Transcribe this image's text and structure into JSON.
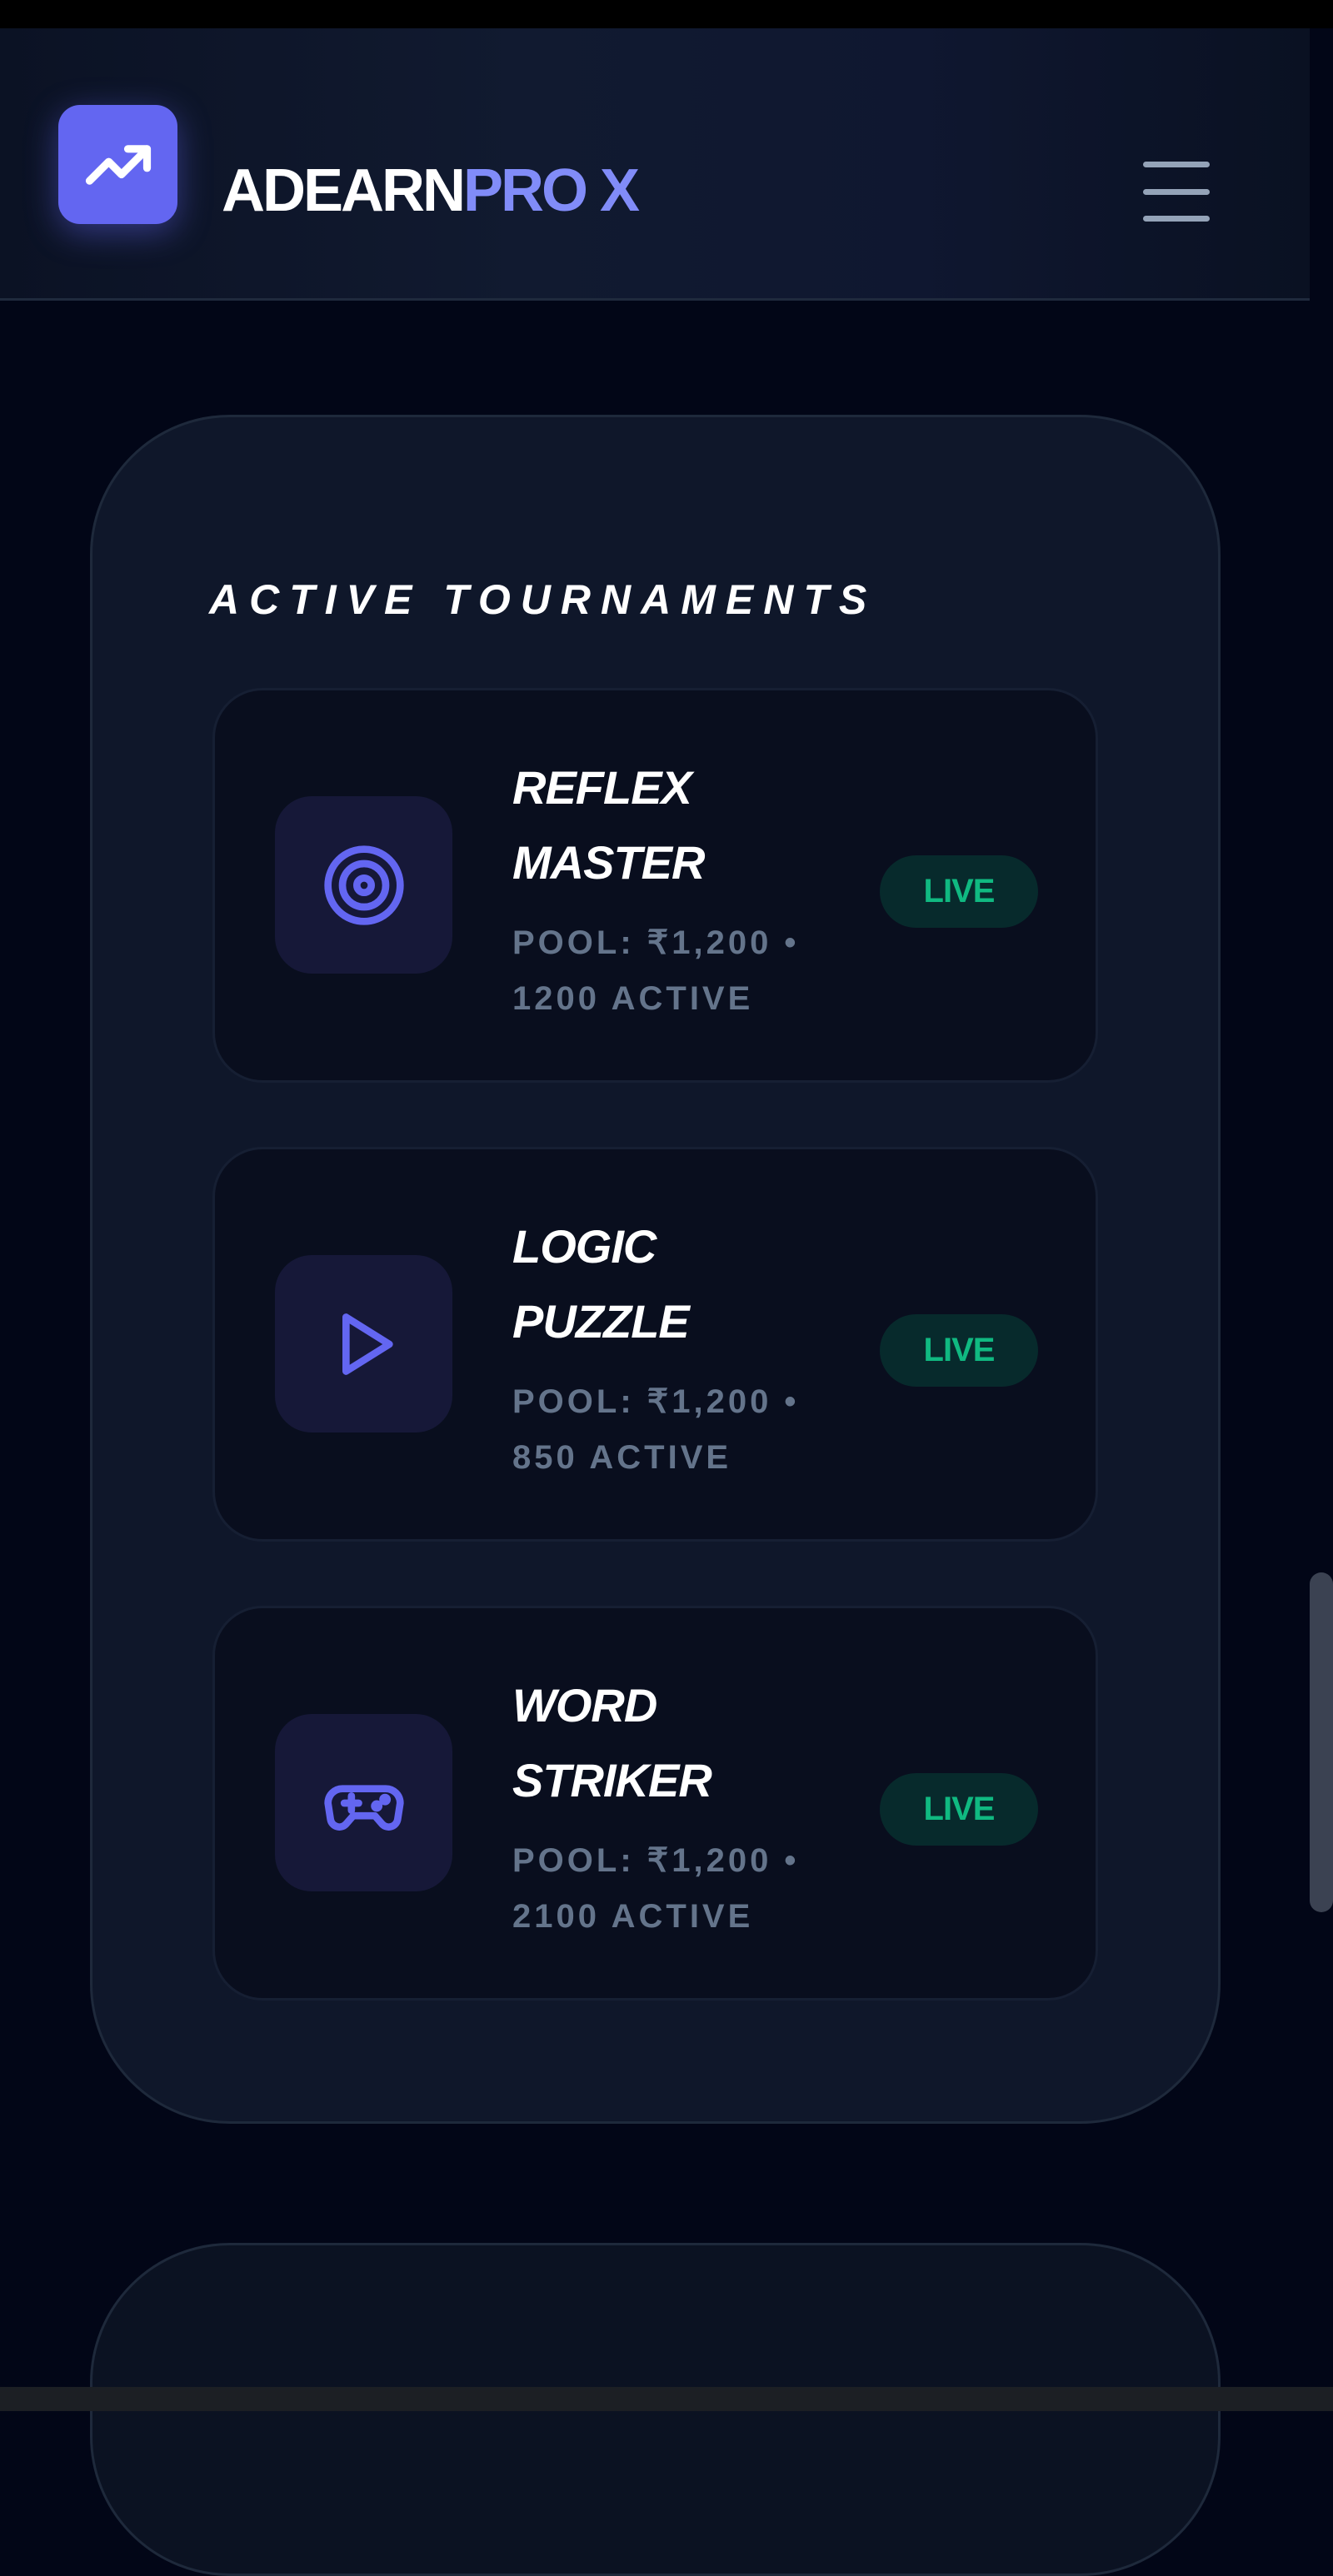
{
  "header": {
    "brand_part1": "ADEARN",
    "brand_part2": "PRO X",
    "logo_icon": "trending-up-icon",
    "menu_icon": "hamburger-menu-icon"
  },
  "tournaments": {
    "title": "ACTIVE TOURNAMENTS",
    "items": [
      {
        "name_line1": "REFLEX",
        "name_line2": "MASTER",
        "meta_line1": "POOL: ₹1,200 •",
        "meta_line2": "1200 ACTIVE",
        "status": "LIVE",
        "icon": "target-icon"
      },
      {
        "name_line1": "LOGIC",
        "name_line2": "PUZZLE",
        "meta_line1": "POOL: ₹1,200 •",
        "meta_line2": "850 ACTIVE",
        "status": "LIVE",
        "icon": "play-icon"
      },
      {
        "name_line1": "WORD",
        "name_line2": "STRIKER",
        "meta_line1": "POOL: ₹1,200 •",
        "meta_line2": "2100 ACTIVE",
        "status": "LIVE",
        "icon": "gamepad-icon"
      }
    ]
  },
  "colors": {
    "accent": "#6366f1",
    "accent_light": "#818cf8",
    "live_green": "#10b981",
    "background": "#020617",
    "panel": "#0f172a",
    "card": "#090e1e"
  }
}
